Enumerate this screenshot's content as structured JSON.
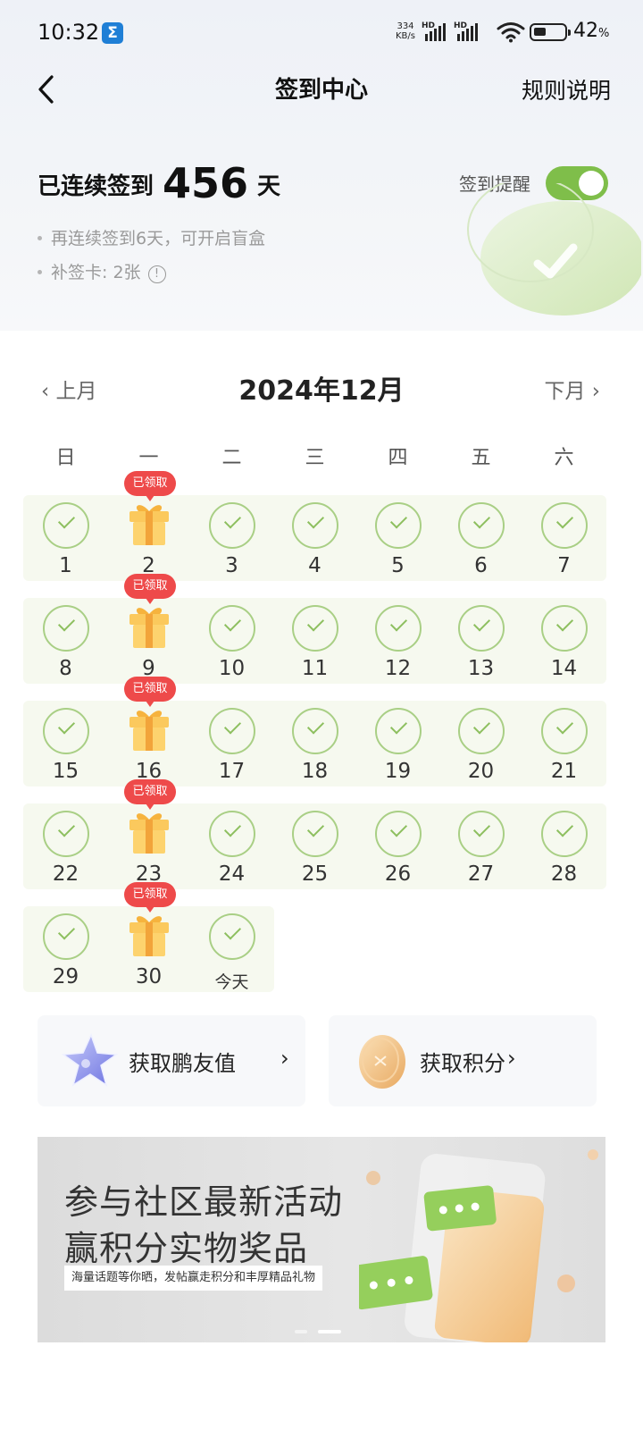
{
  "status_bar": {
    "time": "10:32",
    "app_icon": "Σ",
    "net_speed_value": "334",
    "net_speed_unit": "KB/s",
    "sim1": "HD",
    "sim2": "HD",
    "battery_percent": "42",
    "battery_unit": "%",
    "battery_level": 0.42
  },
  "header": {
    "title": "签到中心",
    "rules_link": "规则说明"
  },
  "streak": {
    "prefix": "已连续签到",
    "days": "456",
    "suffix": "天",
    "reminder_label": "签到提醒",
    "reminder_on": true,
    "tip_1": "再连续签到6天，可开启盲盒",
    "tip_2": "补签卡: 2张",
    "info_icon": "!"
  },
  "calendar": {
    "prev_label": "上月",
    "next_label": "下月",
    "month_title": "2024年12月",
    "weekdays": [
      "日",
      "一",
      "二",
      "三",
      "四",
      "五",
      "六"
    ],
    "gift_tag": "已领取",
    "weeks": [
      [
        {
          "label": "1",
          "type": "checked"
        },
        {
          "label": "2",
          "type": "gift"
        },
        {
          "label": "3",
          "type": "checked"
        },
        {
          "label": "4",
          "type": "checked"
        },
        {
          "label": "5",
          "type": "checked"
        },
        {
          "label": "6",
          "type": "checked"
        },
        {
          "label": "7",
          "type": "checked"
        }
      ],
      [
        {
          "label": "8",
          "type": "checked"
        },
        {
          "label": "9",
          "type": "gift"
        },
        {
          "label": "10",
          "type": "checked"
        },
        {
          "label": "11",
          "type": "checked"
        },
        {
          "label": "12",
          "type": "checked"
        },
        {
          "label": "13",
          "type": "checked"
        },
        {
          "label": "14",
          "type": "checked"
        }
      ],
      [
        {
          "label": "15",
          "type": "checked"
        },
        {
          "label": "16",
          "type": "gift"
        },
        {
          "label": "17",
          "type": "checked"
        },
        {
          "label": "18",
          "type": "checked"
        },
        {
          "label": "19",
          "type": "checked"
        },
        {
          "label": "20",
          "type": "checked"
        },
        {
          "label": "21",
          "type": "checked"
        }
      ],
      [
        {
          "label": "22",
          "type": "checked"
        },
        {
          "label": "23",
          "type": "gift"
        },
        {
          "label": "24",
          "type": "checked"
        },
        {
          "label": "25",
          "type": "checked"
        },
        {
          "label": "26",
          "type": "checked"
        },
        {
          "label": "27",
          "type": "checked"
        },
        {
          "label": "28",
          "type": "checked"
        }
      ],
      [
        {
          "label": "29",
          "type": "checked"
        },
        {
          "label": "30",
          "type": "gift"
        },
        {
          "label": "今天",
          "type": "today"
        }
      ]
    ]
  },
  "cards": {
    "friend_value": {
      "label": "获取鹏友值",
      "icon": "star-icon"
    },
    "points": {
      "label": "获取积分",
      "icon": "coin-icon"
    }
  },
  "banner": {
    "line1": "参与社区最新活动",
    "line2": "赢积分实物奖品",
    "subtitle": "海量话题等你晒，发帖赢走积分和丰厚精品礼物",
    "slide_count": 2,
    "active_slide": 2
  },
  "colors": {
    "accent_green": "#7fbe4a",
    "check_green": "#8dbf5f",
    "tag_red": "#ee4a4a",
    "row_bg": "#f6f9ef"
  }
}
